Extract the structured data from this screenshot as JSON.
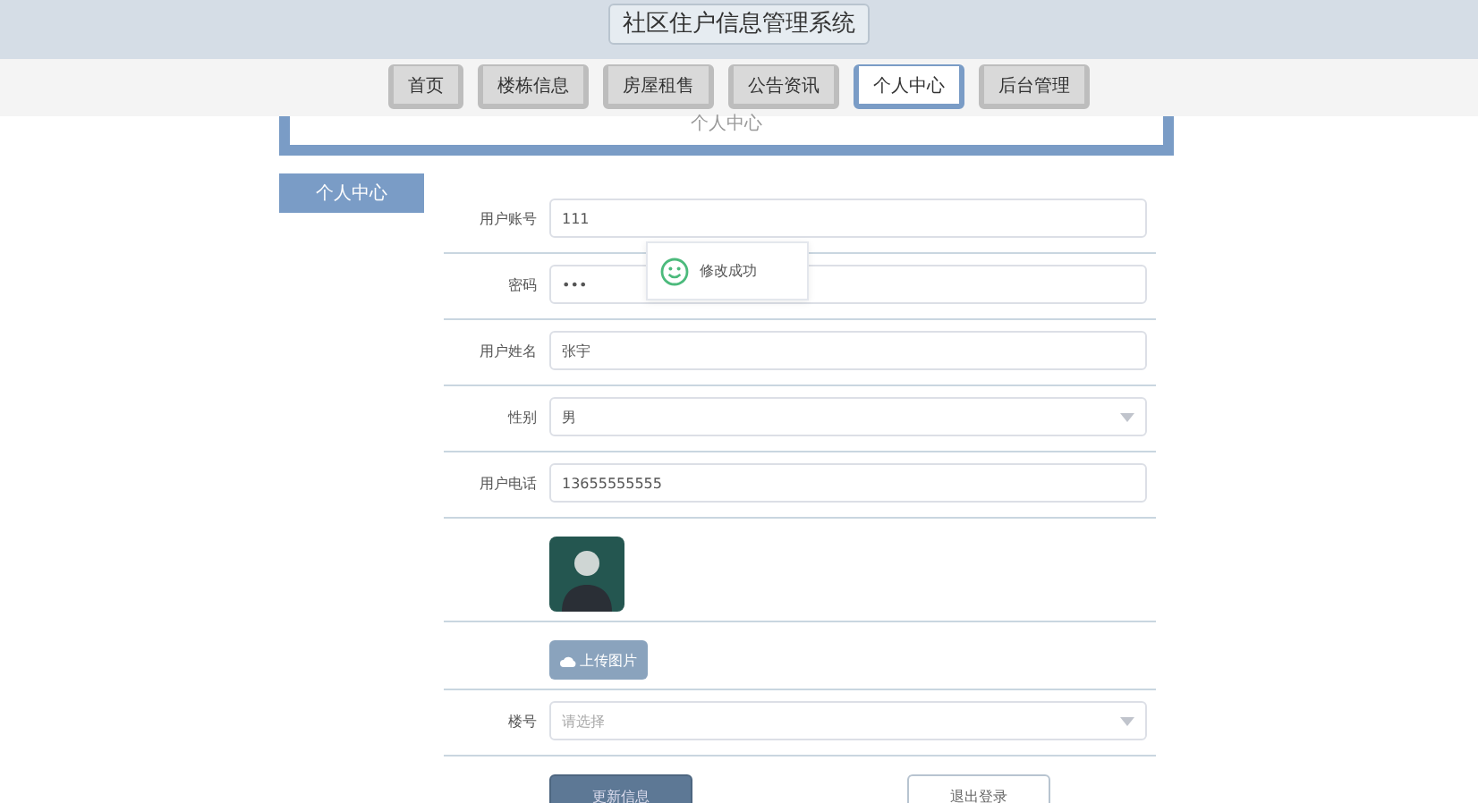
{
  "header": {
    "title": "社区住户信息管理系统"
  },
  "nav": [
    {
      "label": "首页",
      "selected": false
    },
    {
      "label": "楼栋信息",
      "selected": false
    },
    {
      "label": "房屋租售",
      "selected": false
    },
    {
      "label": "公告资讯",
      "selected": false
    },
    {
      "label": "个人中心",
      "selected": true
    },
    {
      "label": "后台管理",
      "selected": false
    }
  ],
  "panel": {
    "title": "个人中心"
  },
  "sidebar": [
    {
      "label": "个人中心",
      "selected": true
    }
  ],
  "form": {
    "rows": [
      {
        "kind": "input",
        "label": "用户账号",
        "value": "111"
      },
      {
        "kind": "input",
        "label": "密码",
        "value": "•••"
      },
      {
        "kind": "input",
        "label": "用户姓名",
        "value": "张宇"
      },
      {
        "kind": "select",
        "label": "性别",
        "value": "男"
      },
      {
        "kind": "input",
        "label": "用户电话",
        "value": "13655555555"
      },
      {
        "kind": "image"
      },
      {
        "kind": "upload",
        "button": "上传图片"
      },
      {
        "kind": "select",
        "label": "楼号",
        "placeholder": "请选择"
      }
    ]
  },
  "buttons": [
    {
      "kind": "primary",
      "label": "更新信息"
    },
    {
      "kind": "plain",
      "label": "退出登录"
    }
  ],
  "toast": {
    "message": "修改成功"
  }
}
